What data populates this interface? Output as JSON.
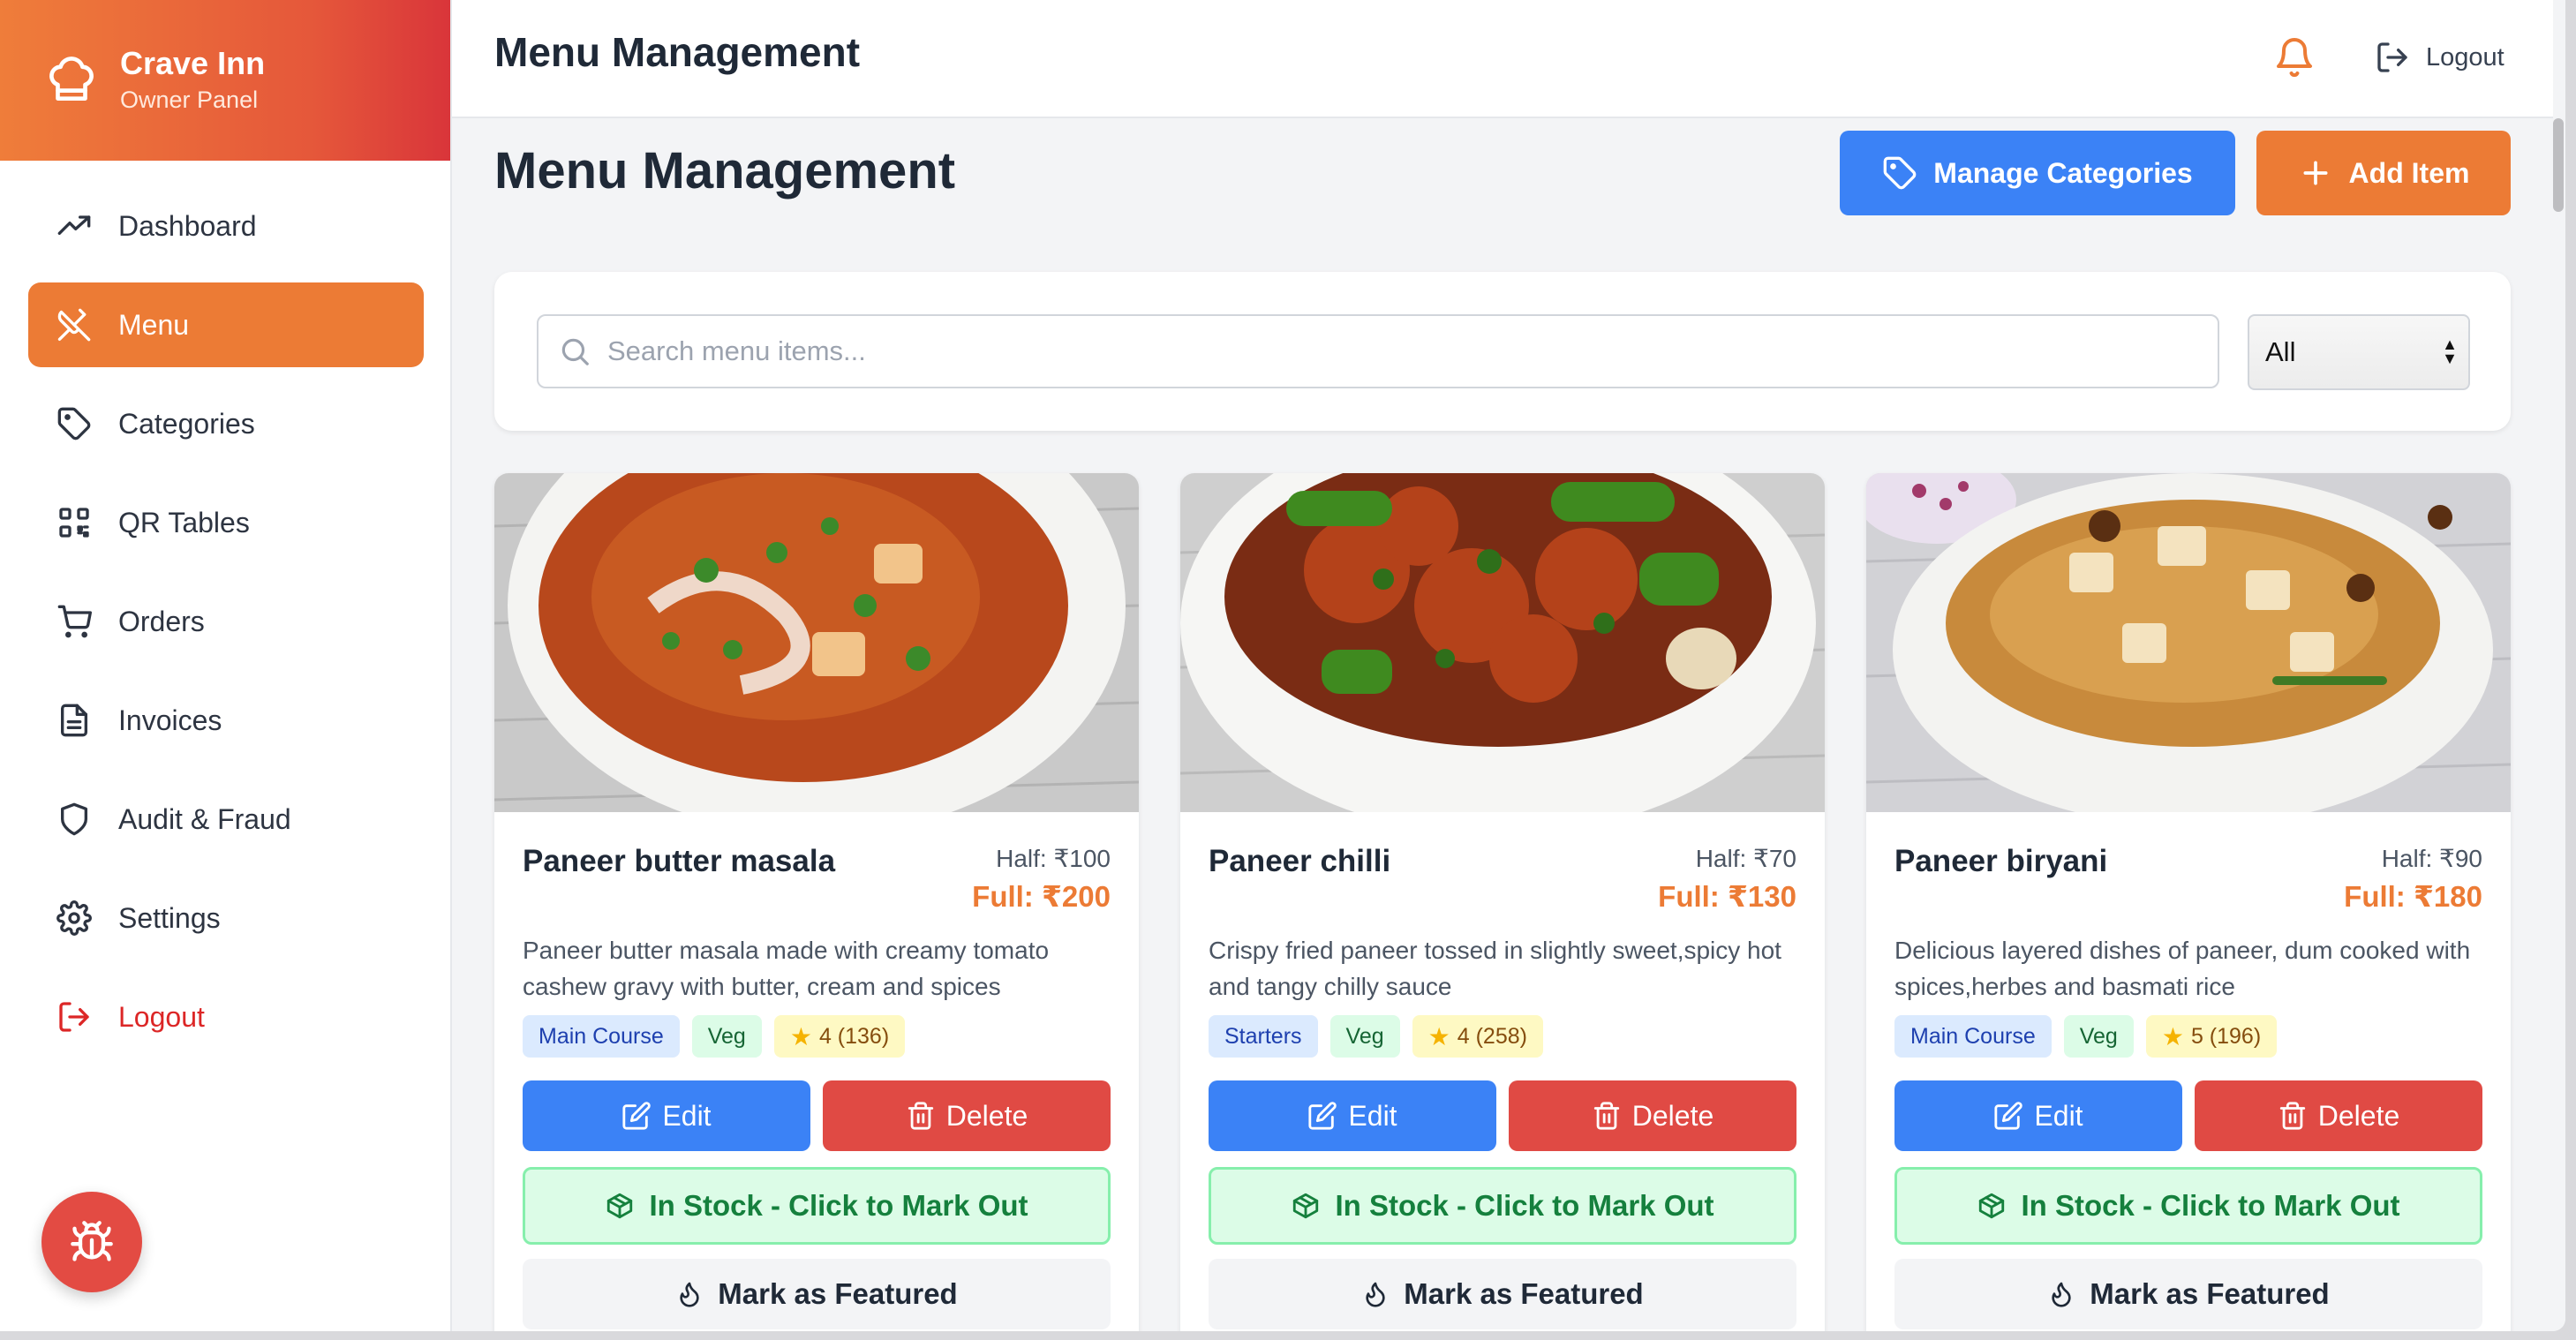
{
  "brand": {
    "name": "Crave Inn",
    "subtitle": "Owner Panel"
  },
  "sidebar": {
    "items": [
      {
        "label": "Dashboard",
        "icon": "trending-up-icon",
        "active": false
      },
      {
        "label": "Menu",
        "icon": "utensils-icon",
        "active": true
      },
      {
        "label": "Categories",
        "icon": "tag-icon",
        "active": false
      },
      {
        "label": "QR Tables",
        "icon": "qr-code-icon",
        "active": false
      },
      {
        "label": "Orders",
        "icon": "cart-icon",
        "active": false
      },
      {
        "label": "Invoices",
        "icon": "file-icon",
        "active": false
      },
      {
        "label": "Audit & Fraud",
        "icon": "shield-icon",
        "active": false
      },
      {
        "label": "Settings",
        "icon": "gear-icon",
        "active": false
      }
    ],
    "logout": "Logout"
  },
  "topbar": {
    "title": "Menu Management",
    "logout": "Logout"
  },
  "main": {
    "title": "Menu Management",
    "manage_categories": "Manage Categories",
    "add_item": "Add Item",
    "search_placeholder": "Search menu items...",
    "filter_selected": "All"
  },
  "colors": {
    "accent": "#ec7b35",
    "primary": "#3b82f6",
    "danger": "#e04a44",
    "success": "#15803d"
  },
  "items": [
    {
      "name": "Paneer butter masala",
      "half": "Half: ₹100",
      "full": "Full: ₹200",
      "description": "Paneer butter masala made with creamy tomato cashew gravy with butter, cream and spices",
      "category": "Main Course",
      "diet": "Veg",
      "rating": "4 (136)",
      "edit": "Edit",
      "delete": "Delete",
      "stock": "In Stock - Click to Mark Out",
      "featured": "Mark as Featured"
    },
    {
      "name": "Paneer chilli",
      "half": "Half: ₹70",
      "full": "Full: ₹130",
      "description": "Crispy fried paneer tossed in slightly sweet,spicy hot and tangy chilly sauce",
      "category": "Starters",
      "diet": "Veg",
      "rating": "4 (258)",
      "edit": "Edit",
      "delete": "Delete",
      "stock": "In Stock - Click to Mark Out",
      "featured": "Mark as Featured"
    },
    {
      "name": "Paneer biryani",
      "half": "Half: ₹90",
      "full": "Full: ₹180",
      "description": "Delicious layered dishes of paneer, dum cooked with spices,herbes and basmati rice",
      "category": "Main Course",
      "diet": "Veg",
      "rating": "5 (196)",
      "edit": "Edit",
      "delete": "Delete",
      "stock": "In Stock - Click to Mark Out",
      "featured": "Mark as Featured"
    }
  ]
}
